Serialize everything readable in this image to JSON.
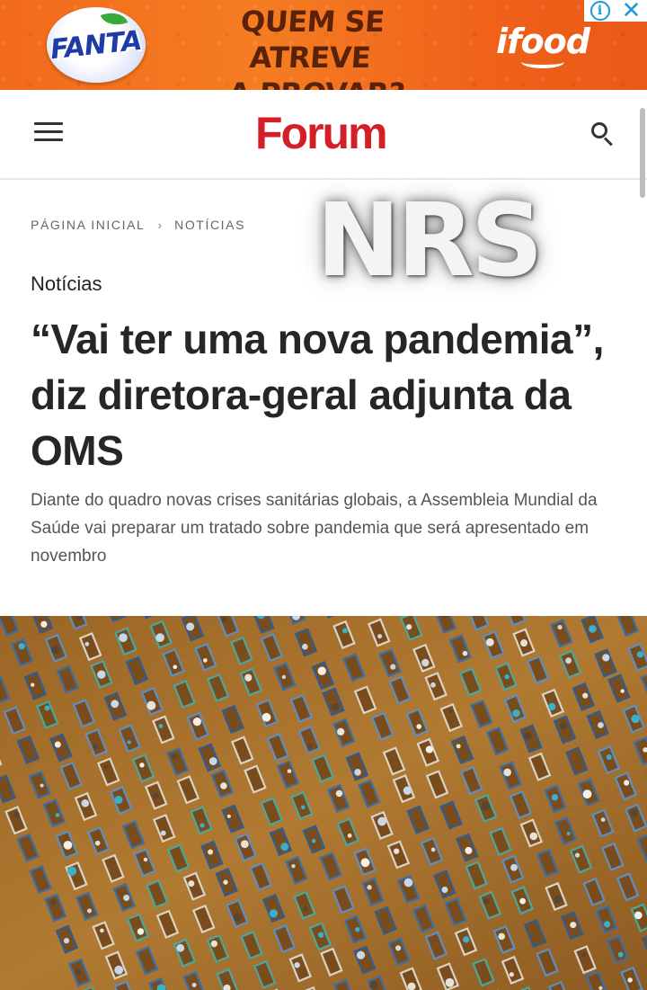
{
  "ad": {
    "brand": "FANTA",
    "slogan_line1": "QUEM SE ATREVE",
    "slogan_line2": "A PROVAR?",
    "partner": "ifood",
    "info_icon": "info-icon",
    "close_icon": "close-icon",
    "colors": {
      "background": "#f26a1c",
      "slogan": "#5a2209",
      "fanta_blue": "#1e3ba8",
      "controls": "#1a9bd7"
    }
  },
  "header": {
    "menu_icon": "hamburger-menu-icon",
    "logo_text": "Forum",
    "search_icon": "search-icon",
    "logo_color": "#d31f27"
  },
  "breadcrumb": {
    "home": "Página Inicial",
    "separator": "›",
    "current": "Notícias"
  },
  "watermark": {
    "text": "NRS"
  },
  "article": {
    "category": "Notícias",
    "headline": "“Vai ter uma nova pandemia”, diz diretora-geral adjunta da OMS",
    "subtitle": "Diante do quadro novas crises sanitárias globais, a Assembleia Mundial da Saúde vai preparar um tratado sobre pandemia que será apresentado em novembro"
  },
  "photo": {
    "subject": "aerial-view-cemetery-graves",
    "colors": {
      "soil": "#a5712b",
      "frame_blue": "#3b6fa8",
      "frame_teal": "#4aa7a0"
    }
  }
}
